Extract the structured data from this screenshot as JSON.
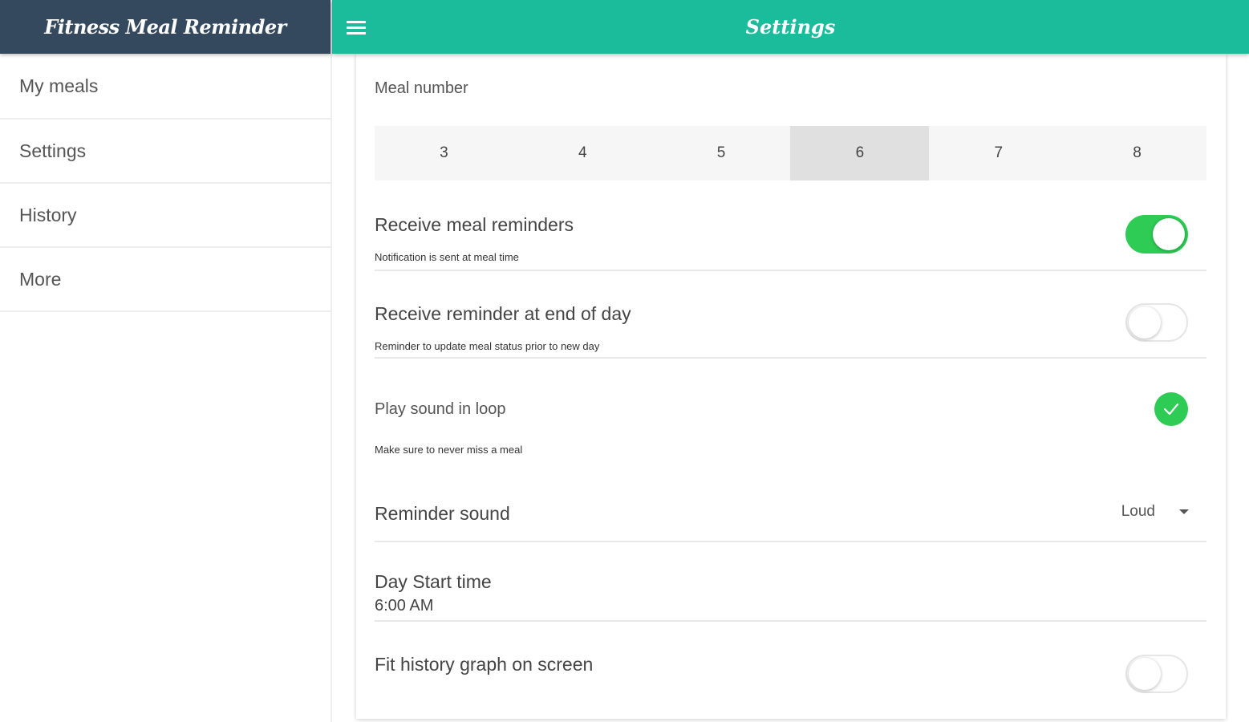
{
  "app": {
    "title": "Fitness Meal Reminder"
  },
  "topbar": {
    "title": "Settings",
    "menu_icon": "hamburger-menu-icon"
  },
  "sidebar": {
    "items": [
      {
        "label": "My meals"
      },
      {
        "label": "Settings"
      },
      {
        "label": "History"
      },
      {
        "label": "More"
      }
    ]
  },
  "settings": {
    "meal_number": {
      "label": "Meal number",
      "options": [
        "3",
        "4",
        "5",
        "6",
        "7",
        "8"
      ],
      "selected": "6"
    },
    "meal_reminders": {
      "title": "Receive meal reminders",
      "subtitle": "Notification is sent at meal time",
      "enabled": true
    },
    "end_of_day": {
      "title": "Receive reminder at end of day",
      "subtitle": "Reminder to update meal status prior to new day",
      "enabled": false
    },
    "sound_loop": {
      "title": "Play sound in loop",
      "subtitle": "Make sure to never miss a meal",
      "checked": true
    },
    "reminder_sound": {
      "title": "Reminder sound",
      "value": "Loud"
    },
    "day_start": {
      "title": "Day Start time",
      "value": "6:00 AM"
    },
    "fit_graph": {
      "title": "Fit history graph on screen",
      "enabled": false
    }
  },
  "colors": {
    "sidebar_header": "#34495e",
    "topbar": "#1abc9c",
    "toggle_on": "#2ecc55"
  }
}
